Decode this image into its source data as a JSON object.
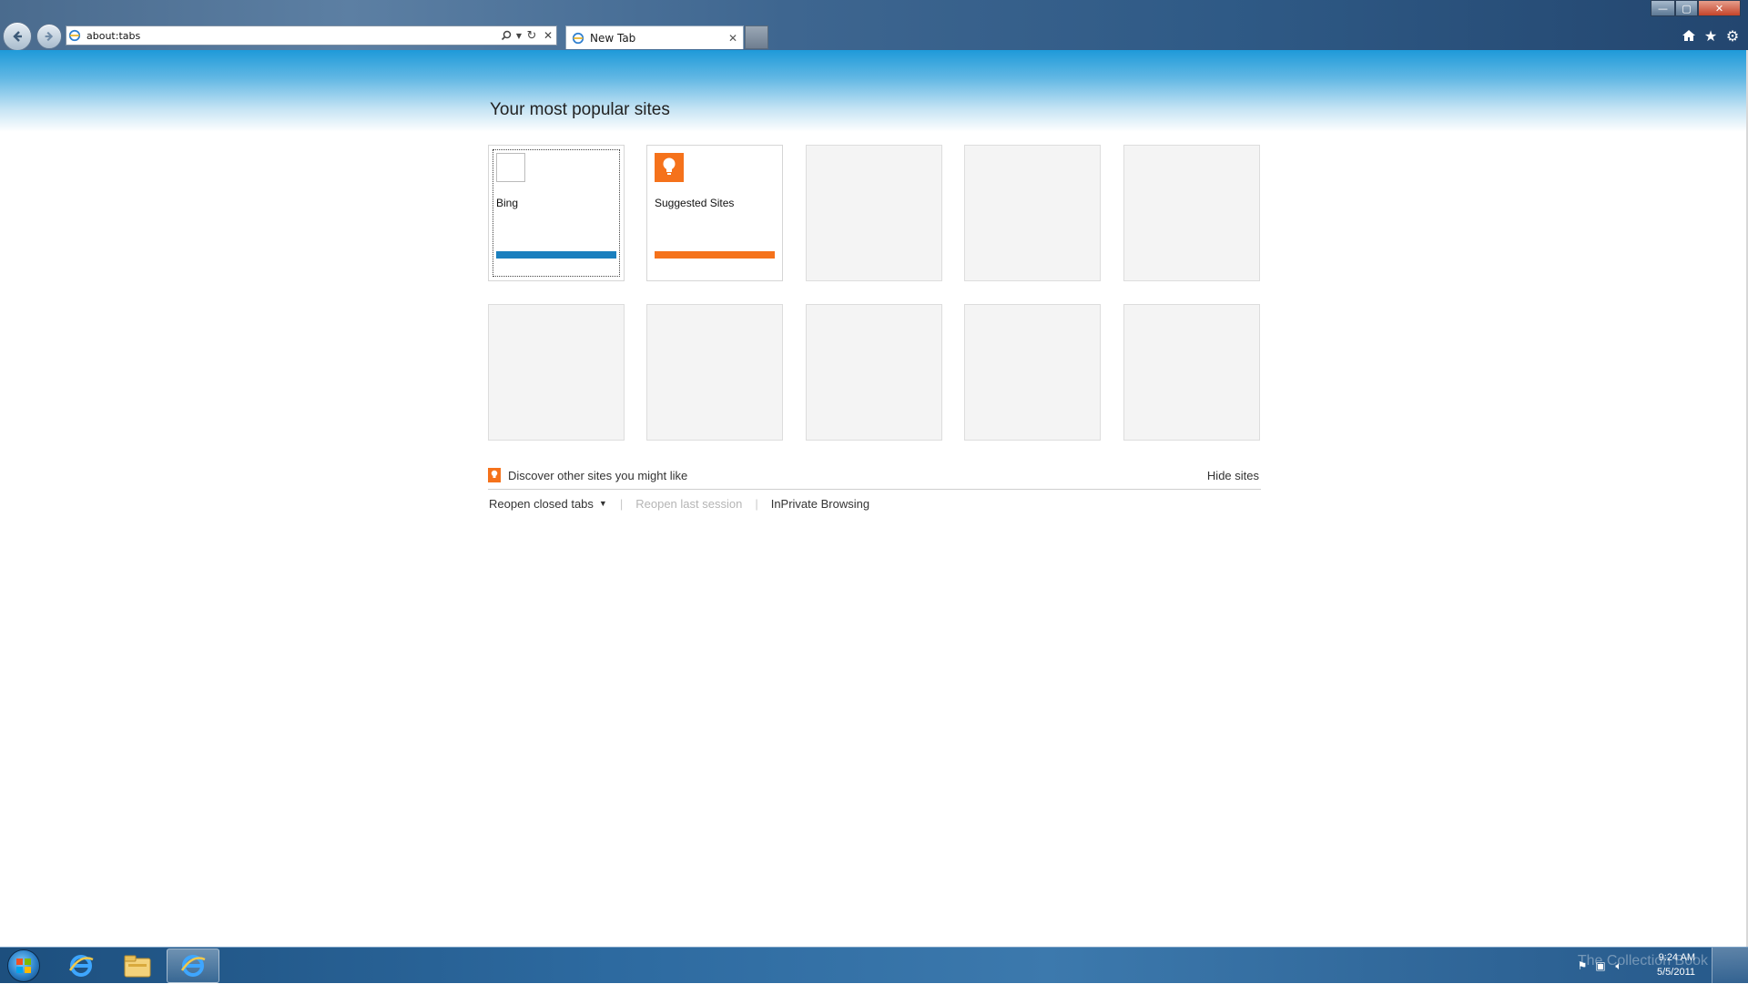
{
  "browser": {
    "address": "about:tabs",
    "tab": {
      "title": "New Tab",
      "close_glyph": "✕"
    },
    "window_controls": {
      "minimize": "—",
      "maximize": "▢",
      "close": "✕"
    },
    "toolbar_icons": [
      "home-icon",
      "star-icon",
      "gear-icon"
    ]
  },
  "page": {
    "heading": "Your most popular sites",
    "tiles": [
      {
        "label": "Bing",
        "favicon": "blank-page-icon",
        "bar_color": "#1a7fbe",
        "selected": true
      },
      {
        "label": "Suggested Sites",
        "favicon": "lightbulb-icon",
        "bar_color": "#f5721b",
        "selected": false
      },
      {
        "label": "",
        "empty": true
      },
      {
        "label": "",
        "empty": true
      },
      {
        "label": "",
        "empty": true
      },
      {
        "label": "",
        "empty": true
      },
      {
        "label": "",
        "empty": true
      },
      {
        "label": "",
        "empty": true
      },
      {
        "label": "",
        "empty": true
      },
      {
        "label": "",
        "empty": true
      }
    ],
    "discover_link": "Discover other sites you might like",
    "hide_sites": "Hide sites",
    "actions": {
      "reopen_closed_tabs": "Reopen closed tabs",
      "reopen_last_session": "Reopen last session",
      "inprivate": "InPrivate Browsing",
      "separator": "|"
    }
  },
  "taskbar": {
    "pinned": [
      "internet-explorer-icon",
      "windows-explorer-icon",
      "internet-explorer-icon"
    ],
    "clock_time": "9:24 AM",
    "clock_date": "5/5/2011",
    "watermark": "The Collection Book"
  },
  "colors": {
    "accent_blue": "#1a7fbe",
    "accent_orange": "#f5721b",
    "chrome_blue": "#2f5a86"
  }
}
